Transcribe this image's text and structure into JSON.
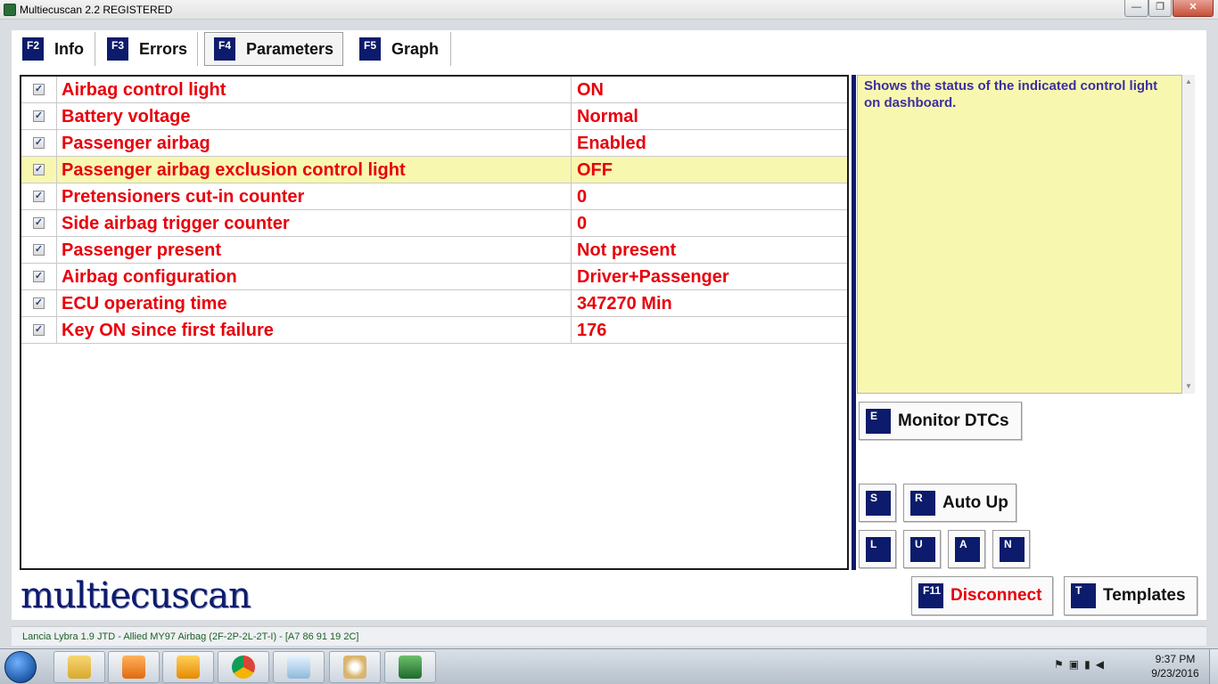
{
  "window": {
    "title": "Multiecuscan 2.2 REGISTERED",
    "minimize": "—",
    "maximize": "❐",
    "close": "✕"
  },
  "tabs": [
    {
      "key": "F2",
      "label": "Info"
    },
    {
      "key": "F3",
      "label": "Errors"
    },
    {
      "key": "F4",
      "label": "Parameters",
      "active": true
    },
    {
      "key": "F5",
      "label": "Graph"
    }
  ],
  "parameters": [
    {
      "checked": true,
      "name": "Airbag control light",
      "value": "ON"
    },
    {
      "checked": true,
      "name": "Battery voltage",
      "value": "Normal"
    },
    {
      "checked": true,
      "name": "Passenger airbag",
      "value": "Enabled"
    },
    {
      "checked": true,
      "name": "Passenger airbag exclusion control light",
      "value": "OFF",
      "selected": true
    },
    {
      "checked": true,
      "name": "Pretensioners cut-in counter",
      "value": "0"
    },
    {
      "checked": true,
      "name": "Side airbag trigger counter",
      "value": "0"
    },
    {
      "checked": true,
      "name": "Passenger present",
      "value": "Not present"
    },
    {
      "checked": true,
      "name": "Airbag configuration",
      "value": "Driver+Passenger"
    },
    {
      "checked": true,
      "name": "ECU operating time",
      "value": "347270 Min"
    },
    {
      "checked": true,
      "name": "Key ON since first failure",
      "value": "176"
    }
  ],
  "description": "Shows the status of the indicated control light on dashboard.",
  "buttons": {
    "monitor_dtcs": {
      "key": "E",
      "label": "Monitor DTCs"
    },
    "s": {
      "key": "S"
    },
    "auto_up": {
      "key": "R",
      "label": "Auto Up"
    },
    "l": {
      "key": "L"
    },
    "u": {
      "key": "U"
    },
    "a": {
      "key": "A"
    },
    "n": {
      "key": "N"
    },
    "disconnect": {
      "key": "F11",
      "label": "Disconnect"
    },
    "templates": {
      "key": "T",
      "label": "Templates"
    }
  },
  "logo": "multiecuscan",
  "status": "Lancia Lybra 1.9 JTD - Allied MY97 Airbag (2F-2P-2L-2T-I) - [A7 86 91 19 2C]",
  "taskbar": {
    "items": [
      "file-explorer-icon",
      "media-player-icon",
      "office-icon",
      "chrome-icon",
      "notepad-icon",
      "paint-icon",
      "multiecuscan-icon"
    ],
    "clock_time": "9:37 PM",
    "clock_date": "9/23/2016"
  },
  "colors": {
    "accent": "#0c1b6b",
    "value_text": "#e8000b",
    "selected_row": "#f8f7b0",
    "description_text": "#3b2fa1",
    "status_text": "#1b5f26"
  }
}
